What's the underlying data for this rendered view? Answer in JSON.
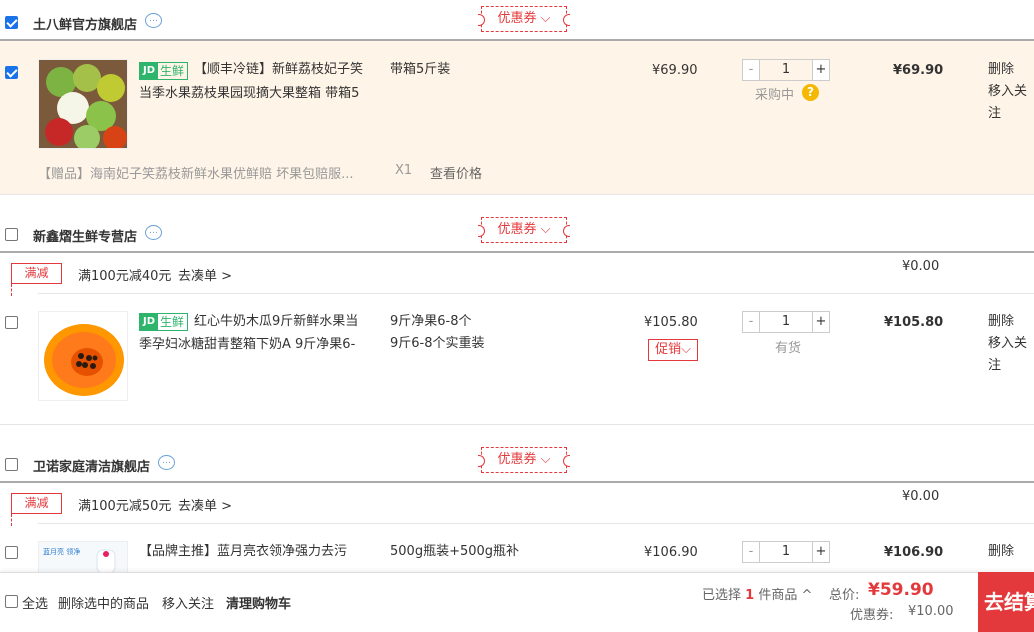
{
  "shops": [
    {
      "name": "土八鲜官方旗舰店",
      "coupon_label": "优惠券",
      "items": [
        {
          "tag": "生鲜",
          "title_line1": "【顺丰冷链】新鲜荔枝妃子笑",
          "title_line2": "当季水果荔枝果园现摘大果整箱 带箱5",
          "spec": "带箱5斤装",
          "price": "¥69.90",
          "quantity": "1",
          "stock": "采购中",
          "subtotal": "¥69.90",
          "ops": [
            "删除",
            "移入关注"
          ],
          "gift": {
            "text": "【赠品】海南妃子笑荔枝新鲜水果优鲜赔 坏果包赔服...",
            "count": "X1",
            "link": "查看价格"
          }
        }
      ]
    },
    {
      "name": "新鑫熠生鲜专营店",
      "coupon_label": "优惠券",
      "promo": {
        "badge": "满减",
        "text": "满100元减40元",
        "link": "去凑单 >",
        "discount": "¥0.00"
      },
      "items": [
        {
          "tag": "生鲜",
          "title_line1": "红心牛奶木瓜9斤新鲜水果当",
          "title_line2": "季孕妇冰糖甜青整箱下奶A 9斤净果6-",
          "spec_line1": "9斤净果6-8个",
          "spec_line2": "9斤6-8个实重装",
          "price": "¥105.80",
          "promo_btn": "促销",
          "quantity": "1",
          "stock": "有货",
          "subtotal": "¥105.80",
          "ops": [
            "删除",
            "移入关注"
          ]
        }
      ]
    },
    {
      "name": "卫诺家庭清洁旗舰店",
      "coupon_label": "优惠券",
      "promo": {
        "badge": "满减",
        "text": "满100元减50元",
        "link": "去凑单 >",
        "discount": "¥0.00"
      },
      "items": [
        {
          "title_line1": "【品牌主推】蓝月亮衣领净强力去污",
          "spec": "500g瓶装+500g瓶补",
          "price": "¥106.90",
          "quantity": "1",
          "subtotal": "¥106.90",
          "ops": [
            "删除"
          ]
        }
      ]
    }
  ],
  "footer": {
    "select_all": "全选",
    "delete_selected": "删除选中的商品",
    "move_to_fav": "移入关注",
    "clear_cart": "清理购物车",
    "selected_prefix": "已选择",
    "selected_count": "1",
    "selected_suffix": "件商品",
    "total_label": "总价:",
    "total_value": "¥59.90",
    "coupon_label": "优惠券:",
    "coupon_value": "¥10.00",
    "checkout": "去结算"
  },
  "colors": {
    "accent": "#e4393c",
    "fresh": "#2eb56b",
    "highlight_row": "#fff4e8"
  }
}
